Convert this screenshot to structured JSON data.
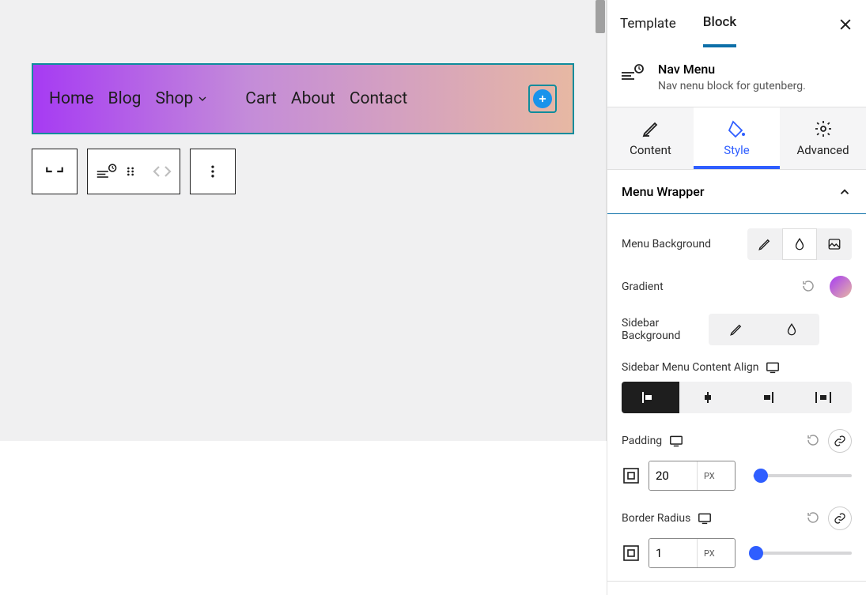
{
  "tabs": {
    "template": "Template",
    "block": "Block"
  },
  "block": {
    "title": "Nav Menu",
    "desc": "Nav nenu block for gutenberg."
  },
  "subtabs": {
    "content": "Content",
    "style": "Style",
    "advanced": "Advanced"
  },
  "panel": {
    "menu_wrapper": "Menu Wrapper"
  },
  "controls": {
    "menu_bg": "Menu Background",
    "gradient": "Gradient",
    "sidebar_bg": "Sidebar Background",
    "sidebar_align": "Sidebar Menu Content Align",
    "padding": "Padding",
    "border_radius": "Border Radius"
  },
  "units": {
    "px": "PX"
  },
  "values": {
    "padding": "20",
    "border_radius": "1"
  },
  "nav": {
    "items": [
      "Home",
      "Blog",
      "Shop",
      "Cart",
      "About",
      "Contact"
    ]
  }
}
